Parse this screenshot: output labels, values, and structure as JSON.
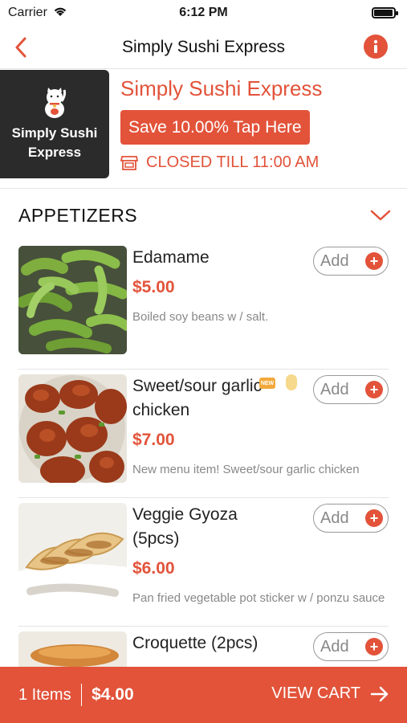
{
  "status": {
    "carrier": "Carrier",
    "time": "6:12 PM",
    "battery_level": 0.95
  },
  "nav": {
    "title": "Simply Sushi Express"
  },
  "restaurant": {
    "logo_text": "Simply Sushi Express",
    "name": "Simply Sushi Express",
    "promo_label": "Save 10.00% Tap Here",
    "status_text": "CLOSED TILL 11:00 AM"
  },
  "section": {
    "title": "APPETIZERS"
  },
  "items": [
    {
      "name": "Edamame",
      "price": "$5.00",
      "description": "Boiled soy beans w / salt.",
      "add_label": "Add"
    },
    {
      "name": "Sweet/sour garlic chicken",
      "price": "$7.00",
      "description": "New menu item! Sweet/sour garlic chicken",
      "add_label": "Add",
      "badge_new": "NEW"
    },
    {
      "name": "Veggie Gyoza (5pcs)",
      "price": "$6.00",
      "description": "Pan fried vegetable pot sticker w / ponzu sauce",
      "add_label": "Add"
    },
    {
      "name": "Croquette (2pcs)",
      "add_label": "Add"
    }
  ],
  "cart": {
    "count_label": "1 Items",
    "total": "$4.00",
    "view_label": "VIEW CART"
  },
  "colors": {
    "accent": "#e2533a",
    "logo_bg": "#2b2b2b"
  }
}
